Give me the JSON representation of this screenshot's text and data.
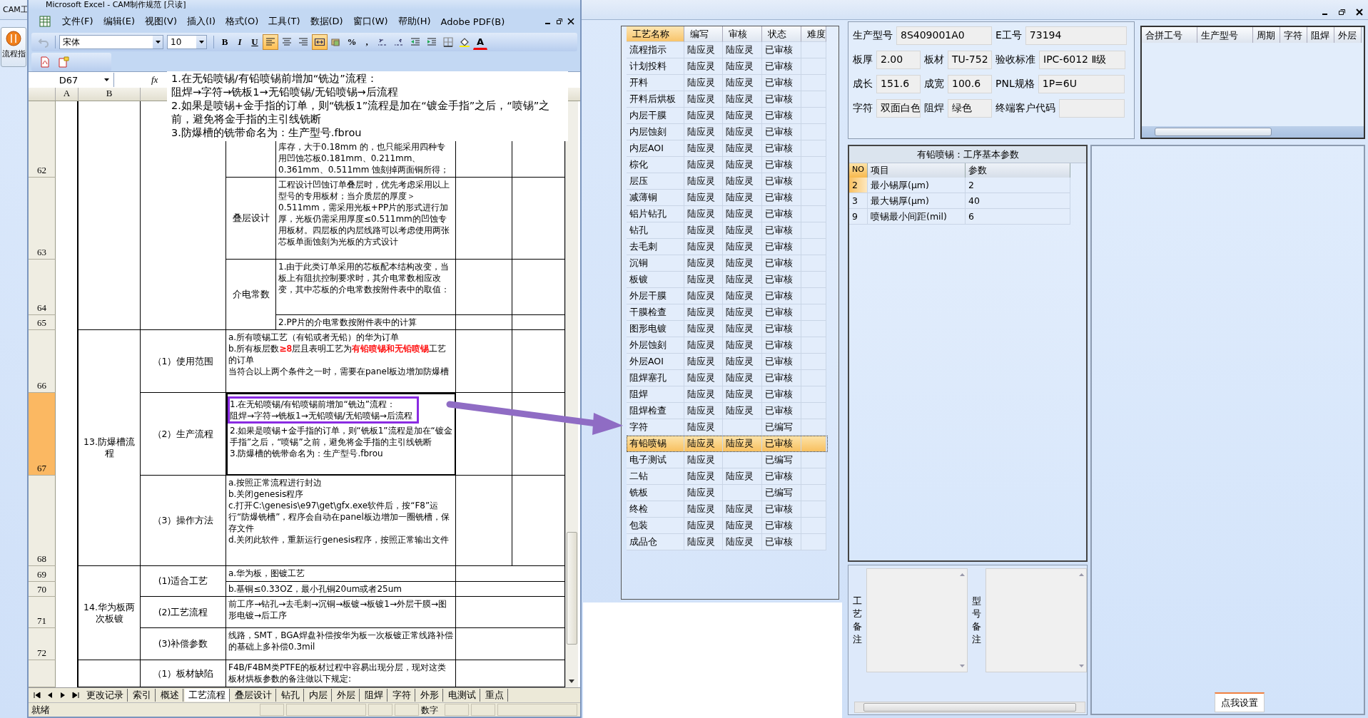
{
  "app": {
    "title": "CAM工",
    "sidebar_button": "流程指"
  },
  "excel": {
    "title": "Microsoft Excel - CAM制作规范  [只读]",
    "menu": [
      "文件(F)",
      "编辑(E)",
      "视图(V)",
      "插入(I)",
      "格式(O)",
      "工具(T)",
      "数据(D)",
      "窗口(W)",
      "帮助(H)",
      "Adobe PDF(B)"
    ],
    "toolbar": [
      {
        "kind": "undo",
        "disabled": true
      },
      {
        "kind": "font",
        "value": "宋体"
      },
      {
        "kind": "size",
        "value": "10"
      },
      {
        "kind": "text",
        "label": "B",
        "selected": false
      },
      {
        "kind": "text",
        "label": "I",
        "selected": false
      },
      {
        "kind": "text",
        "label": "U",
        "selected": false
      },
      {
        "kind": "icon",
        "selected": true
      },
      {
        "kind": "icon",
        "selected": false
      },
      {
        "kind": "icon",
        "selected": false
      },
      {
        "kind": "icon",
        "selected": true
      },
      {
        "kind": "icon",
        "selected": false
      },
      {
        "kind": "text",
        "label": "%",
        "selected": false
      },
      {
        "kind": "text",
        "label": ",",
        "selected": false
      },
      {
        "kind": "icon",
        "selected": false
      },
      {
        "kind": "icon",
        "selected": false
      },
      {
        "kind": "icon",
        "selected": false
      },
      {
        "kind": "icon",
        "selected": false
      },
      {
        "kind": "icon",
        "selected": false
      },
      {
        "kind": "icon",
        "selected": false
      },
      {
        "kind": "color",
        "label": "A",
        "selected": false
      }
    ],
    "name_box": "D67",
    "function_label": "fx",
    "formula": [
      "1.在无铅喷锡/有铅喷锡前增加“铣边”流程：",
      "阻焊→字符→铣板1→无铅喷锡/无铅喷锡→后流程",
      "2.如果是喷锡+金手指的订单，则“铣板1”流程是加在“镀金手指”之后，“喷锡”之前，避免将金手指的主引线铣断",
      "3.防爆槽的铣带命名为：生产型号.fbrou"
    ],
    "columns": [
      "A",
      "B"
    ],
    "row_headers": [
      {
        "label": "62",
        "selected": false
      },
      {
        "label": "63",
        "selected": false
      },
      {
        "label": "64",
        "selected": false
      },
      {
        "label": "65",
        "selected": false
      },
      {
        "label": "66",
        "selected": false
      },
      {
        "label": "67",
        "selected": true
      },
      {
        "label": "68",
        "selected": false
      },
      {
        "label": "69",
        "selected": false
      },
      {
        "label": "70",
        "selected": false
      },
      {
        "label": "71",
        "selected": false
      },
      {
        "label": "72",
        "selected": false
      },
      {
        "selected": false
      }
    ],
    "blocks": [
      {
        "kind": "detail",
        "items": [
          {
            "rows": [
              {
                "lines": [
                  "库存，大于0.18mm 的，也只能采用四种专用凹蚀芯板0.181mm、0.211mm、0.361mm、0.511mm 蚀刻掉两面铜所得；"
                ]
              }
            ]
          },
          {
            "label": "叠层设计",
            "rows": [
              {
                "lines": [
                  "工程设计凹蚀订单叠层时，优先考虑采用以上型号的专用板材；当介质层的厚度＞0.511mm，需采用光板+PP片的形式进行加厚，光板仍需采用厚度≤0.511mm的凹蚀专用板材。四层板的内层线路可以考虑使用两张芯板单面蚀刻为光板的方式设计"
                ]
              }
            ]
          },
          {
            "label": "介电常数",
            "rows": [
              {
                "lines": [
                  "1.由于此类订单采用的芯板配本结构改变，当板上有阻抗控制要求时，其介电常数相应改变，其中芯板的介电常数按附件表中的取值："
                ]
              },
              {
                "lines": [
                  "2.PP片的介电常数按附件表中的计算"
                ]
              }
            ]
          }
        ]
      },
      {
        "kind": "split",
        "title": "13.防爆槽流程",
        "items": [
          {
            "label": "（1）使用范围",
            "rows": [
              {
                "lines": [
                  "a.所有喷锡工艺（有铅或者无铅）的华为订单",
                  [
                    {
                      "text": "b.所有板层数"
                    },
                    {
                      "text": "≥8",
                      "color": "#ff0000"
                    },
                    {
                      "text": "层且表明工艺为"
                    },
                    {
                      "text": "有铅喷锡和无铅喷锡",
                      "color": "#ff0000"
                    },
                    {
                      "text": "工艺的订单"
                    }
                  ],
                  "当符合以上两个条件之一时，需要在panel板边增加防爆槽"
                ]
              }
            ]
          },
          {
            "label": "（2）生产流程",
            "rows": [
              {
                "selected": true,
                "highlighted": true,
                "lines": [
                  "1.在无铅喷锡/有铅喷锡前增加“铣边”流程：",
                  "阻焊→字符→铣板1→无铅喷锡/无铅喷锡→后流程",
                  "2.如果是喷锡+金手指的订单，则“铣板1”流程是加在“镀金手指”之后，“喷锡”之前，避免将金手指的主引线铣断",
                  "3.防爆槽的铣带命名为：生产型号.fbrou"
                ]
              }
            ]
          },
          {
            "label": "（3）操作方法",
            "rows": [
              {
                "lines": [
                  "a.按照正常流程进行封边",
                  "b.关闭genesis程序",
                  "c.打开C:\\genesis\\e97\\get\\gfx.exe软件后，按“F8”运行“防爆铣槽”，程序会自动在panel板边增加一圈铣槽，保存文件",
                  "d.关闭此软件，重新运行genesis程序，按照正常输出文件"
                ]
              }
            ]
          }
        ]
      },
      {
        "kind": "merged",
        "title": "14.华为板两次板镀",
        "items": [
          {
            "label": "(1)适合工艺",
            "rows": [
              {
                "lines": [
                  "a.华为板，图镀工艺"
                ]
              },
              {
                "lines": [
                  "b.基铜≤0.33OZ，最小孔铜20um或者25um"
                ]
              }
            ]
          },
          {
            "label": "(2)工艺流程",
            "rows": [
              {
                "lines": [
                  "前工序→钻孔→去毛刺→沉铜→板镀→板镀1→外层干膜→图形电镀→后工序"
                ]
              }
            ]
          },
          {
            "label": "(3)补偿参数",
            "rows": [
              {
                "lines": [
                  "线路，SMT，BGA焊盘补偿按华为板一次板镀正常线路补偿的基础上多补偿0.3mil"
                ]
              }
            ]
          }
        ]
      },
      {
        "kind": "merged",
        "items": [
          {
            "label": "（1）板材缺陷",
            "rows": [
              {
                "lines": [
                  "F4B/F4BM类PTFE的板材过程中容易出现分层，现对这类板材烘板参数的备注做以下规定:"
                ]
              }
            ]
          }
        ]
      }
    ],
    "sheet_tabs": [
      {
        "label": "更改记录",
        "selected": false
      },
      {
        "label": "索引",
        "selected": false
      },
      {
        "label": "概述",
        "selected": false
      },
      {
        "label": "工艺流程",
        "selected": true
      },
      {
        "label": "叠层设计",
        "selected": false
      },
      {
        "label": "钻孔",
        "selected": false
      },
      {
        "label": "内层",
        "selected": false
      },
      {
        "label": "外层",
        "selected": false
      },
      {
        "label": "阻焊",
        "selected": false
      },
      {
        "label": "字符",
        "selected": false
      },
      {
        "label": "外形",
        "selected": false
      },
      {
        "label": "电测试",
        "selected": false
      },
      {
        "label": "重点",
        "selected": false
      }
    ],
    "status": "就绪",
    "status_mode": "数字"
  },
  "process_table": {
    "columns": [
      {
        "label": "工艺名称",
        "selected": true
      },
      {
        "label": "编写",
        "selected": false
      },
      {
        "label": "审核",
        "selected": false
      },
      {
        "label": "状态",
        "selected": false
      },
      {
        "label": "难度",
        "selected": false
      }
    ],
    "rows": [
      {
        "name": "流程指示",
        "writer": "陆应灵",
        "reviewer": "陆应灵",
        "status": "已审核",
        "selected": false
      },
      {
        "name": "计划投料",
        "writer": "陆应灵",
        "reviewer": "陆应灵",
        "status": "已审核",
        "selected": false
      },
      {
        "name": "开料",
        "writer": "陆应灵",
        "reviewer": "陆应灵",
        "status": "已审核",
        "selected": false
      },
      {
        "name": "开料后烘板",
        "writer": "陆应灵",
        "reviewer": "陆应灵",
        "status": "已审核",
        "selected": false
      },
      {
        "name": "内层干膜",
        "writer": "陆应灵",
        "reviewer": "陆应灵",
        "status": "已审核",
        "selected": false
      },
      {
        "name": "内层蚀刻",
        "writer": "陆应灵",
        "reviewer": "陆应灵",
        "status": "已审核",
        "selected": false
      },
      {
        "name": "内层AOI",
        "writer": "陆应灵",
        "reviewer": "陆应灵",
        "status": "已审核",
        "selected": false
      },
      {
        "name": "棕化",
        "writer": "陆应灵",
        "reviewer": "陆应灵",
        "status": "已审核",
        "selected": false
      },
      {
        "name": "层压",
        "writer": "陆应灵",
        "reviewer": "陆应灵",
        "status": "已审核",
        "selected": false
      },
      {
        "name": "减薄铜",
        "writer": "陆应灵",
        "reviewer": "陆应灵",
        "status": "已审核",
        "selected": false
      },
      {
        "name": "铝片钻孔",
        "writer": "陆应灵",
        "reviewer": "陆应灵",
        "status": "已审核",
        "selected": false
      },
      {
        "name": "钻孔",
        "writer": "陆应灵",
        "reviewer": "陆应灵",
        "status": "已审核",
        "selected": false
      },
      {
        "name": "去毛刺",
        "writer": "陆应灵",
        "reviewer": "陆应灵",
        "status": "已审核",
        "selected": false
      },
      {
        "name": "沉铜",
        "writer": "陆应灵",
        "reviewer": "陆应灵",
        "status": "已审核",
        "selected": false
      },
      {
        "name": "板镀",
        "writer": "陆应灵",
        "reviewer": "陆应灵",
        "status": "已审核",
        "selected": false
      },
      {
        "name": "外层干膜",
        "writer": "陆应灵",
        "reviewer": "陆应灵",
        "status": "已审核",
        "selected": false
      },
      {
        "name": "干膜检查",
        "writer": "陆应灵",
        "reviewer": "陆应灵",
        "status": "已审核",
        "selected": false
      },
      {
        "name": "图形电镀",
        "writer": "陆应灵",
        "reviewer": "陆应灵",
        "status": "已审核",
        "selected": false
      },
      {
        "name": "外层蚀刻",
        "writer": "陆应灵",
        "reviewer": "陆应灵",
        "status": "已审核",
        "selected": false
      },
      {
        "name": "外层AOI",
        "writer": "陆应灵",
        "reviewer": "陆应灵",
        "status": "已审核",
        "selected": false
      },
      {
        "name": "阻焊塞孔",
        "writer": "陆应灵",
        "reviewer": "陆应灵",
        "status": "已审核",
        "selected": false
      },
      {
        "name": "阻焊",
        "writer": "陆应灵",
        "reviewer": "陆应灵",
        "status": "已审核",
        "selected": false
      },
      {
        "name": "阻焊检查",
        "writer": "陆应灵",
        "reviewer": "陆应灵",
        "status": "已审核",
        "selected": false
      },
      {
        "name": "字符",
        "writer": "陆应灵",
        "status": "已编写",
        "selected": false
      },
      {
        "name": "有铅喷锡",
        "writer": "陆应灵",
        "reviewer": "陆应灵",
        "status": "已审核",
        "selected": true
      },
      {
        "name": "电子测试",
        "writer": "陆应灵",
        "status": "已编写",
        "selected": false
      },
      {
        "name": "二钻",
        "writer": "陆应灵",
        "reviewer": "陆应灵",
        "status": "已审核",
        "selected": false
      },
      {
        "name": "铣板",
        "writer": "陆应灵",
        "status": "已编写",
        "selected": false
      },
      {
        "name": "终检",
        "writer": "陆应灵",
        "reviewer": "陆应灵",
        "status": "已审核",
        "selected": false
      },
      {
        "name": "包装",
        "writer": "陆应灵",
        "reviewer": "陆应灵",
        "status": "已审核",
        "selected": false
      },
      {
        "name": "成品仓",
        "writer": "陆应灵",
        "reviewer": "陆应灵",
        "status": "已审核",
        "selected": false
      }
    ]
  },
  "info": {
    "fields": [
      {
        "label": "生产型号",
        "value": "8S409001A0"
      },
      {
        "label": "E工号",
        "value": "73194"
      },
      {
        "label": "板厚",
        "value": "2.00"
      },
      {
        "label": "板材",
        "value": "TU-752"
      },
      {
        "label": "验收标准",
        "value": "IPC-6012 Ⅱ级"
      },
      {
        "label": "成长",
        "value": "151.6"
      },
      {
        "label": "成宽",
        "value": "100.6"
      },
      {
        "label": "PNL规格",
        "value": "1P=6U"
      },
      {
        "label": "字符",
        "value": "双面白色"
      },
      {
        "label": "阻焊",
        "value": "绿色"
      },
      {
        "label": "终端客户代码"
      }
    ]
  },
  "merge_table": {
    "columns": [
      "合拼工号",
      "生产型号",
      "周期",
      "字符",
      "阻焊",
      "外层"
    ]
  },
  "params": {
    "title": "有铅喷锡：工序基本参数",
    "columns": [
      {
        "label": "NO",
        "selected": true
      },
      {
        "label": "项目",
        "selected": false
      },
      {
        "label": "参数",
        "selected": false
      }
    ],
    "rows": [
      {
        "no": "2",
        "item": "最小锡厚(μm)",
        "value": "2",
        "selected": true
      },
      {
        "no": "3",
        "item": "最大锡厚(μm)",
        "value": "40",
        "selected": false
      },
      {
        "no": "9",
        "item": "喷锡最小间距(mil)",
        "value": "6",
        "selected": false
      }
    ]
  },
  "notes": [
    {
      "label": "工艺备注"
    },
    {
      "label": "型号备注"
    }
  ],
  "settings_button": "点我设置"
}
